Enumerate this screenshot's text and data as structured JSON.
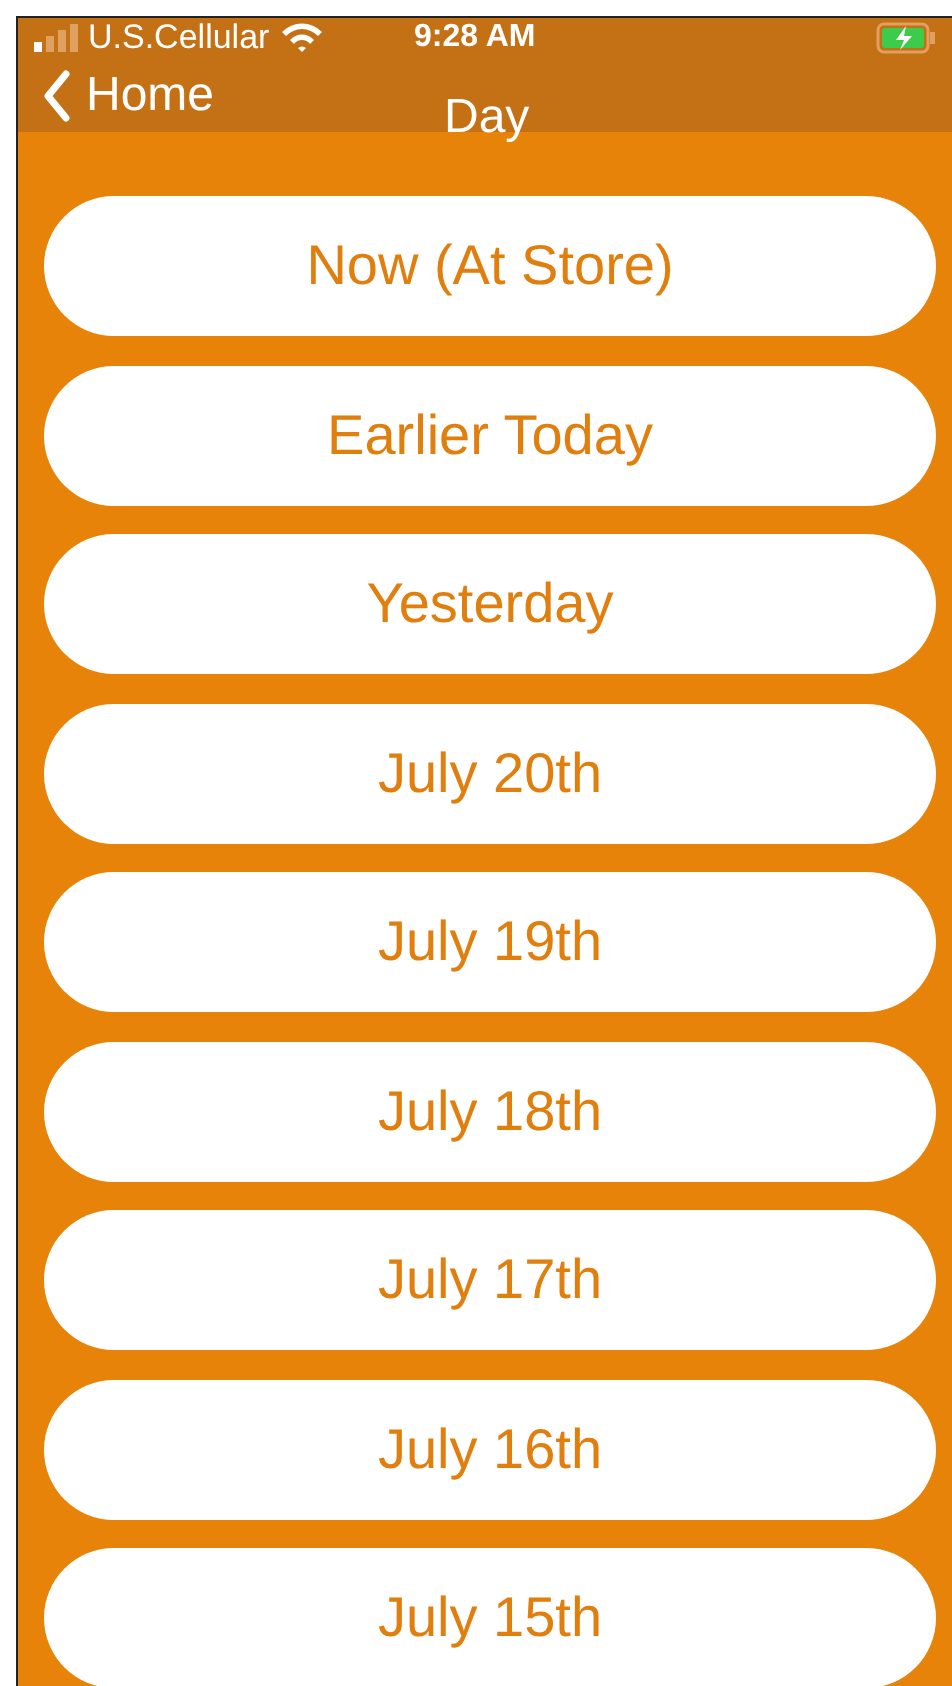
{
  "status_bar": {
    "carrier": "U.S.Cellular",
    "time": "9:28 AM"
  },
  "nav": {
    "back": "Home",
    "title": "Day"
  },
  "days": [
    {
      "label": "Now (At Store)"
    },
    {
      "label": "Earlier Today"
    },
    {
      "label": "Yesterday"
    },
    {
      "label": "July 20th"
    },
    {
      "label": "July 19th"
    },
    {
      "label": "July 18th"
    },
    {
      "label": "July 17th"
    },
    {
      "label": "July 16th"
    },
    {
      "label": "July 15th"
    }
  ]
}
